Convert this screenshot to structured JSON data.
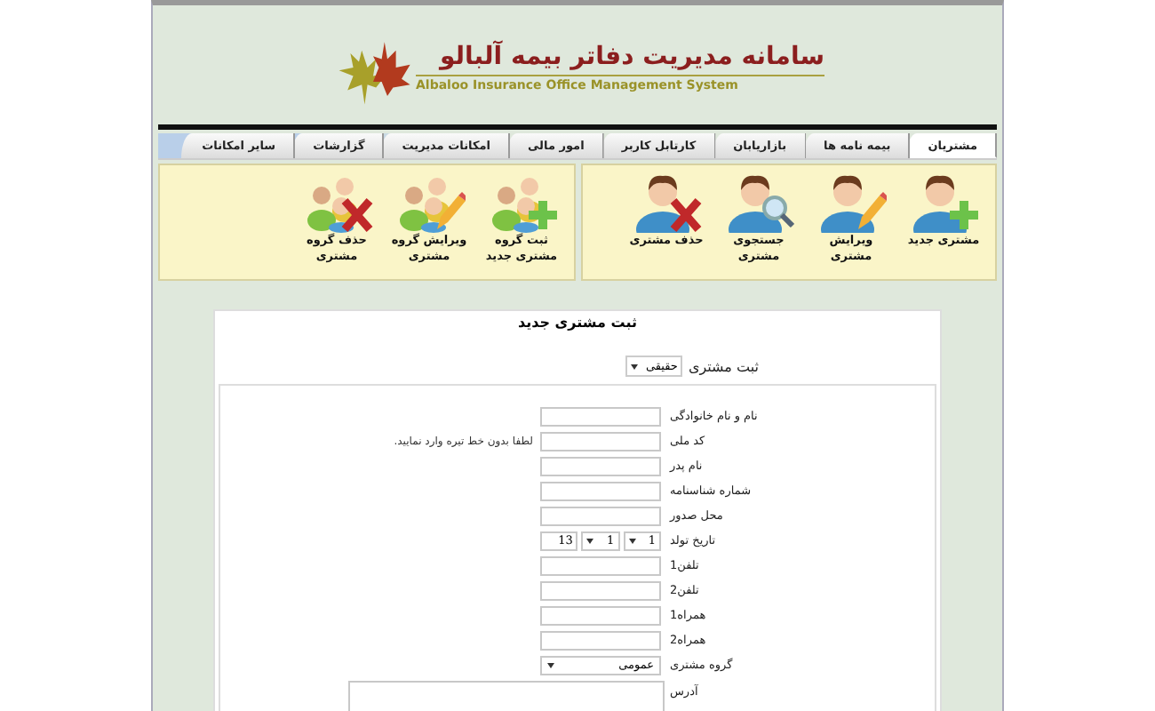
{
  "header": {
    "title": "سامانه مدیریت دفاتر بیمه آلبالو",
    "subtitle": "Albaloo Insurance Office Management System"
  },
  "tabs": [
    {
      "label": "مشتریان",
      "selected": true
    },
    {
      "label": "بیمه نامه ها",
      "selected": false
    },
    {
      "label": "بازاریابان",
      "selected": false
    },
    {
      "label": "کارتابل کاربر",
      "selected": false
    },
    {
      "label": "امور مالی",
      "selected": false
    },
    {
      "label": "امکانات مدیریت",
      "selected": false
    },
    {
      "label": "گزارشات",
      "selected": false
    },
    {
      "label": "سایر امکانات",
      "selected": false
    }
  ],
  "toolbar_groups": [
    {
      "items": [
        {
          "label": "مشتری جدید",
          "group": false,
          "kind": "add"
        },
        {
          "label": "ویرایش مشتری",
          "group": false,
          "kind": "edit"
        },
        {
          "label": "جستجوی مشتری",
          "group": false,
          "kind": "search"
        },
        {
          "label": "حذف مشتری",
          "group": false,
          "kind": "delete"
        }
      ]
    },
    {
      "items": [
        {
          "label": "ثبت گروه مشتری جدید",
          "group": true,
          "kind": "add"
        },
        {
          "label": "ویرایش گروه مشتری",
          "group": true,
          "kind": "edit"
        },
        {
          "label": "حذف گروه مشتری",
          "group": true,
          "kind": "delete"
        }
      ]
    }
  ],
  "form": {
    "title": "ثبت مشتری جدید",
    "type_select": {
      "label": "ثبت مشتری",
      "value": "حقیقی"
    },
    "fields": [
      {
        "kind": "text",
        "label": "نام و نام خانوادگی"
      },
      {
        "kind": "text",
        "label": "کد ملی",
        "note": "لطفا بدون خط تیره وارد نمایید."
      },
      {
        "kind": "text",
        "label": "نام پدر"
      },
      {
        "kind": "text",
        "label": "شماره شناسنامه"
      },
      {
        "kind": "text",
        "label": "محل صدور"
      },
      {
        "kind": "date",
        "label": "تاریخ تولد",
        "values": [
          "1",
          "1",
          "13"
        ]
      },
      {
        "kind": "text",
        "label": "تلفن1"
      },
      {
        "kind": "text",
        "label": "تلفن2"
      },
      {
        "kind": "text",
        "label": "همراه1"
      },
      {
        "kind": "text",
        "label": "همراه2"
      },
      {
        "kind": "select",
        "label": "گروه مشتری",
        "value": "عمومی"
      },
      {
        "kind": "textarea",
        "label": "آدرس"
      }
    ]
  }
}
